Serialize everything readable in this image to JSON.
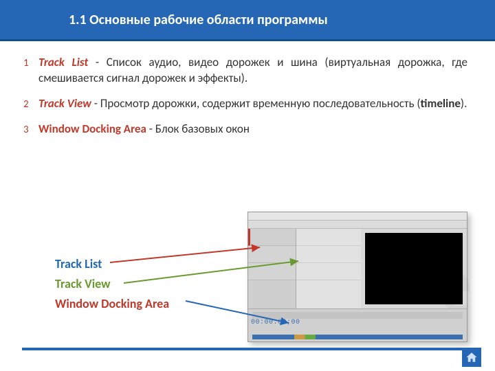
{
  "header": {
    "title": "1.1 Основные рабочие области программы"
  },
  "items": [
    {
      "num": "1",
      "term": "Track List",
      "desc": " - Список аудио, видео дорожек и шина (виртуальная дорожка, где смешивается сигнал дорожек и эффекты)."
    },
    {
      "num": "2",
      "term": "Track View",
      "desc_a": " - Просмотр дорожки, содержит временную последовательность",
      "desc_b": " (",
      "desc_bold": "timeline",
      "desc_c": ")."
    },
    {
      "num": "3",
      "term": "Window Docking Area",
      "desc": " - Блок базовых окон"
    }
  ],
  "legend": {
    "l1": "Track List",
    "l2": "Track View",
    "l3": "Window Docking Area"
  },
  "screenshot": {
    "timecode": "00:00:00;00"
  },
  "colors": {
    "accent": "#2566b5",
    "term": "#c0392b",
    "green": "#6a9a2f"
  }
}
